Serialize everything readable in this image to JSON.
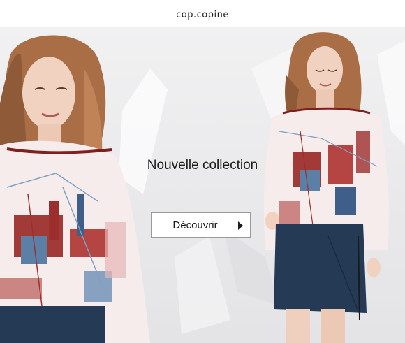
{
  "header": {
    "brand": "cop.copine"
  },
  "hero": {
    "headline": "Nouvelle collection",
    "cta_label": "Découvrir",
    "cta_icon": "play-arrow-icon"
  },
  "colors": {
    "background": "#ececee",
    "text": "#1b1b1b",
    "blouse": "#f6ecec",
    "print_red": "#9c2f2e",
    "print_blue": "#5c7fa6",
    "skirt_navy": "#243a55",
    "hair": "#a96e46"
  }
}
